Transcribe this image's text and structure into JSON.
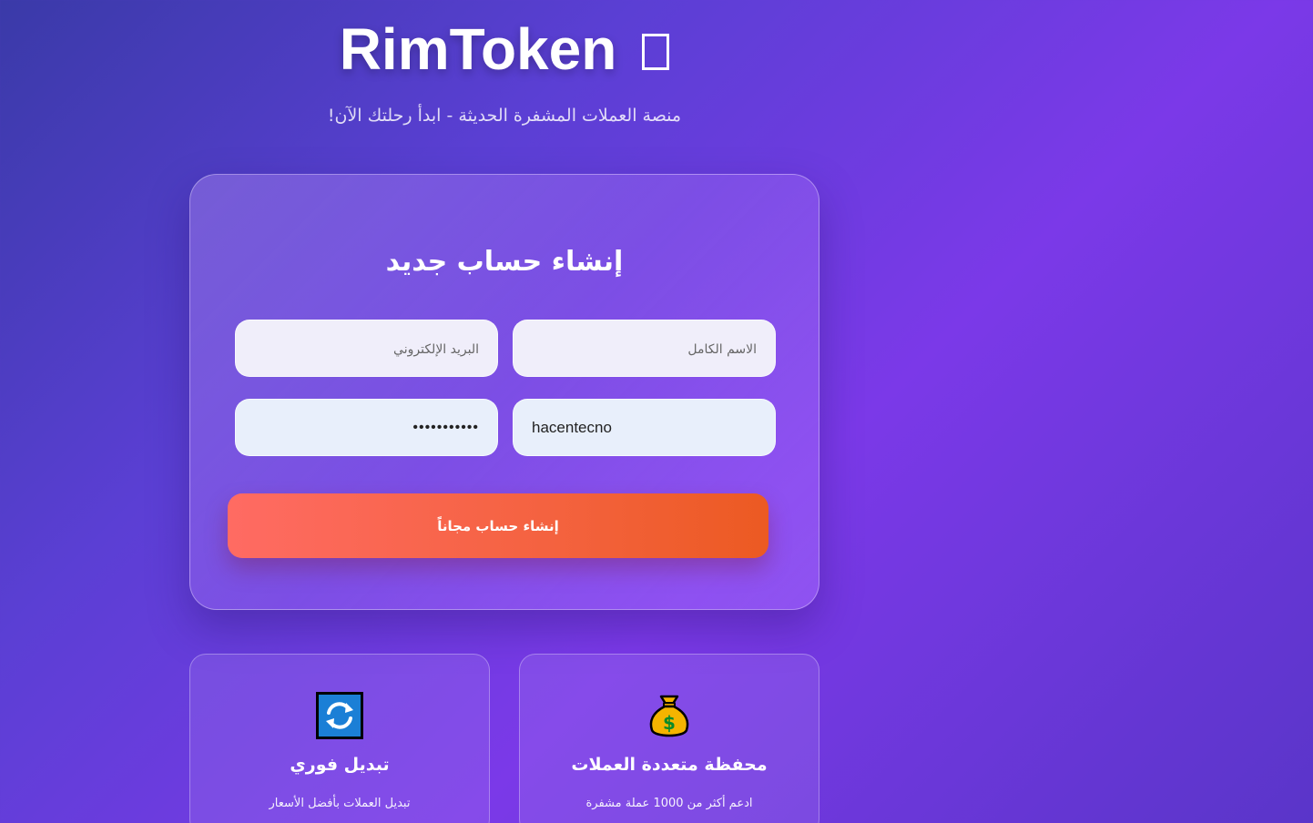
{
  "header": {
    "brand": "RimToken",
    "subtitle": "منصة العملات المشفرة الحديثة - ابدأ رحلتك الآن!"
  },
  "signup": {
    "title": "إنشاء حساب جديد",
    "fullname_placeholder": "الاسم الكامل",
    "email_placeholder": "البريد الإلكتروني",
    "username_value": "hacentecno",
    "password_value": "•••••••••••",
    "submit_label": "إنشاء حساب مجاناً"
  },
  "features": [
    {
      "icon": "refresh-icon",
      "title": "تبديل فوري",
      "description": "تبديل العملات بأفضل الأسعار"
    },
    {
      "icon": "money-bag-icon",
      "title": "محفظة متعددة العملات",
      "description": "ادعم أكثر من 1000 عملة مشفرة"
    }
  ],
  "colors": {
    "background_start": "#3a3aa8",
    "background_end": "#7b39e8",
    "button_start": "#ff6b63",
    "button_end": "#ec5a22"
  }
}
